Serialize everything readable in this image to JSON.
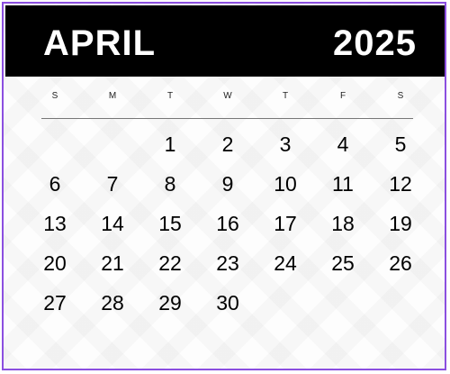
{
  "header": {
    "month": "APRIL",
    "year": "2025"
  },
  "weekdays": [
    "S",
    "M",
    "T",
    "W",
    "T",
    "F",
    "S"
  ],
  "days": [
    "",
    "",
    "1",
    "2",
    "3",
    "4",
    "5",
    "6",
    "7",
    "8",
    "9",
    "10",
    "11",
    "12",
    "13",
    "14",
    "15",
    "16",
    "17",
    "18",
    "19",
    "20",
    "21",
    "22",
    "23",
    "24",
    "25",
    "26",
    "27",
    "28",
    "29",
    "30",
    "",
    "",
    ""
  ],
  "colors": {
    "header_bg": "#000000",
    "header_text": "#ffffff",
    "border_accent": "#8b4fe0"
  }
}
